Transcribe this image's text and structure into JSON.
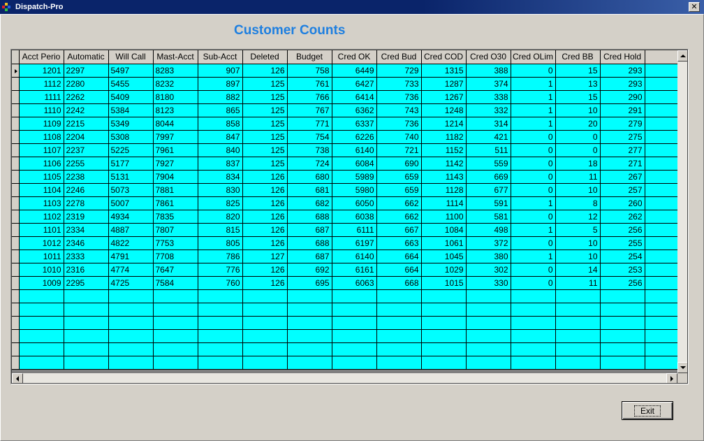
{
  "window": {
    "title": "Dispatch-Pro",
    "close_glyph": "✕"
  },
  "page": {
    "title": "Customer Counts"
  },
  "grid": {
    "columns": [
      "Acct Perio",
      "Automatic",
      "Will Call",
      "Mast-Acct",
      "Sub-Acct",
      "Deleted",
      "Budget",
      "Cred OK",
      "Cred Bud",
      "Cred COD",
      "Cred O30",
      "Cred OLim",
      "Cred BB",
      "Cred Hold",
      ""
    ],
    "rows": [
      [
        "1201",
        "2297",
        "5497",
        "8283",
        "907",
        "126",
        "758",
        "6449",
        "729",
        "1315",
        "388",
        "0",
        "15",
        "293"
      ],
      [
        "1112",
        "2280",
        "5455",
        "8232",
        "897",
        "125",
        "761",
        "6427",
        "733",
        "1287",
        "374",
        "1",
        "13",
        "293"
      ],
      [
        "1111",
        "2262",
        "5409",
        "8180",
        "882",
        "125",
        "766",
        "6414",
        "736",
        "1267",
        "338",
        "1",
        "15",
        "290"
      ],
      [
        "1110",
        "2242",
        "5384",
        "8123",
        "865",
        "125",
        "767",
        "6362",
        "743",
        "1248",
        "332",
        "1",
        "10",
        "291"
      ],
      [
        "1109",
        "2215",
        "5349",
        "8044",
        "858",
        "125",
        "771",
        "6337",
        "736",
        "1214",
        "314",
        "1",
        "20",
        "279"
      ],
      [
        "1108",
        "2204",
        "5308",
        "7997",
        "847",
        "125",
        "754",
        "6226",
        "740",
        "1182",
        "421",
        "0",
        "0",
        "275"
      ],
      [
        "1107",
        "2237",
        "5225",
        "7961",
        "840",
        "125",
        "738",
        "6140",
        "721",
        "1152",
        "511",
        "0",
        "0",
        "277"
      ],
      [
        "1106",
        "2255",
        "5177",
        "7927",
        "837",
        "125",
        "724",
        "6084",
        "690",
        "1142",
        "559",
        "0",
        "18",
        "271"
      ],
      [
        "1105",
        "2238",
        "5131",
        "7904",
        "834",
        "126",
        "680",
        "5989",
        "659",
        "1143",
        "669",
        "0",
        "11",
        "267"
      ],
      [
        "1104",
        "2246",
        "5073",
        "7881",
        "830",
        "126",
        "681",
        "5980",
        "659",
        "1128",
        "677",
        "0",
        "10",
        "257"
      ],
      [
        "1103",
        "2278",
        "5007",
        "7861",
        "825",
        "126",
        "682",
        "6050",
        "662",
        "1114",
        "591",
        "1",
        "8",
        "260"
      ],
      [
        "1102",
        "2319",
        "4934",
        "7835",
        "820",
        "126",
        "688",
        "6038",
        "662",
        "1100",
        "581",
        "0",
        "12",
        "262"
      ],
      [
        "1101",
        "2334",
        "4887",
        "7807",
        "815",
        "126",
        "687",
        "6111",
        "667",
        "1084",
        "498",
        "1",
        "5",
        "256"
      ],
      [
        "1012",
        "2346",
        "4822",
        "7753",
        "805",
        "126",
        "688",
        "6197",
        "663",
        "1061",
        "372",
        "0",
        "10",
        "255"
      ],
      [
        "1011",
        "2333",
        "4791",
        "7708",
        "786",
        "127",
        "687",
        "6140",
        "664",
        "1045",
        "380",
        "1",
        "10",
        "254"
      ],
      [
        "1010",
        "2316",
        "4774",
        "7647",
        "776",
        "126",
        "692",
        "6161",
        "664",
        "1029",
        "302",
        "0",
        "14",
        "253"
      ],
      [
        "1009",
        "2295",
        "4725",
        "7584",
        "760",
        "126",
        "695",
        "6063",
        "668",
        "1015",
        "330",
        "0",
        "11",
        "256"
      ]
    ],
    "empty_rows": 6,
    "row_color": "#00ffff"
  },
  "buttons": {
    "exit_label": "Exit"
  },
  "icons": {
    "app": "dispatch-pro-icon",
    "scroll_up": "arrow-up-icon",
    "scroll_down": "arrow-down-icon",
    "scroll_left": "arrow-left-icon",
    "scroll_right": "arrow-right-icon"
  }
}
